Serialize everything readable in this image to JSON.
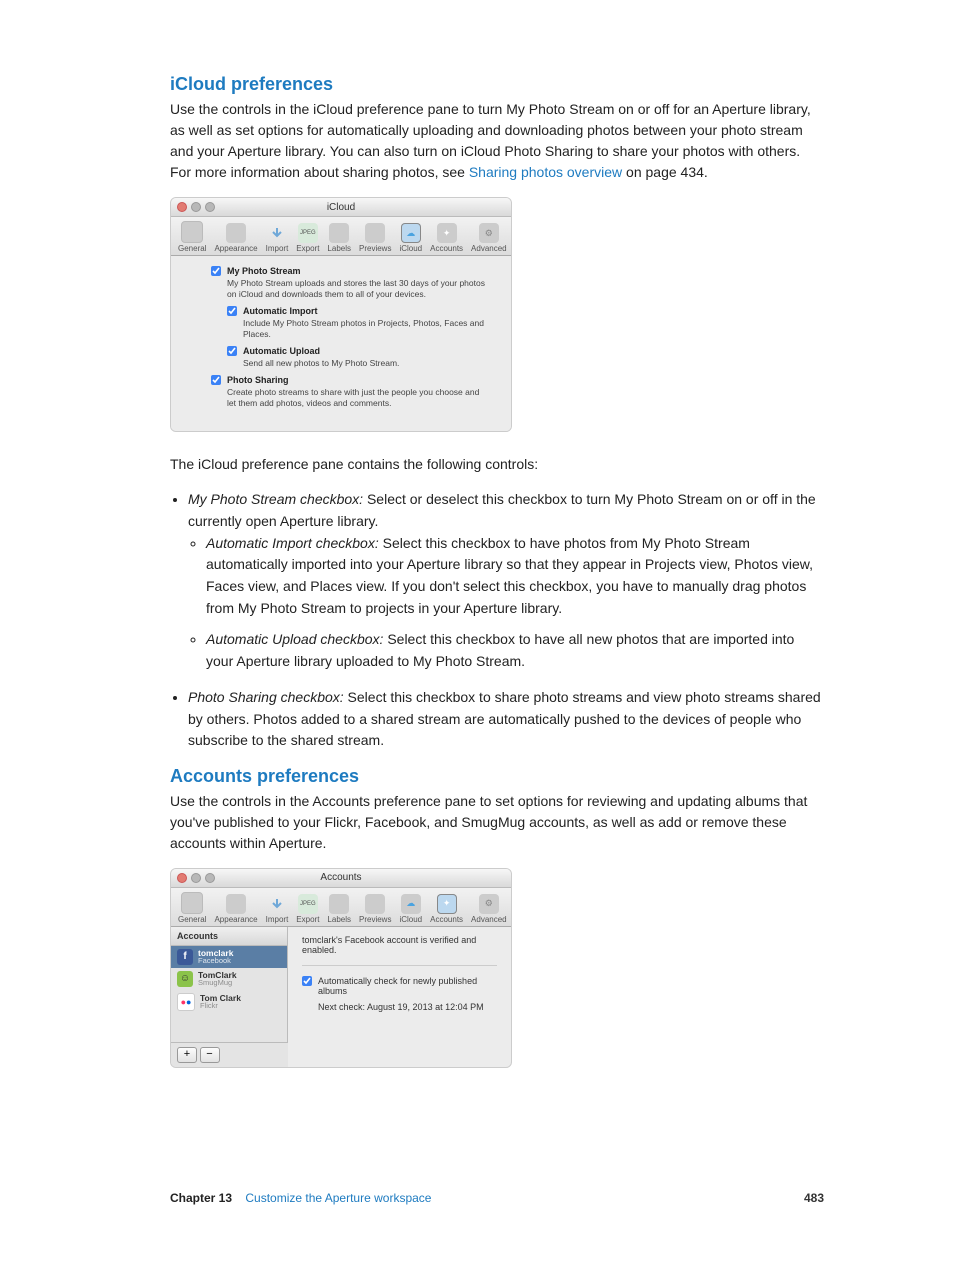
{
  "section1": {
    "title": "iCloud preferences",
    "intro_a": "Use the controls in the iCloud preference pane to turn My Photo Stream on or off for an Aperture library, as well as set options for automatically uploading and downloading photos between your photo stream and your Aperture library. You can also turn on iCloud Photo Sharing to share your photos with others. For more information about sharing photos, see ",
    "intro_link": "Sharing photos overview",
    "intro_b": " on page 434.",
    "lead_out": "The iCloud preference pane contains the following controls:"
  },
  "icloud_window": {
    "title": "iCloud",
    "tabs": [
      "General",
      "Appearance",
      "Import",
      "Export",
      "Labels",
      "Previews",
      "iCloud",
      "Accounts",
      "Advanced"
    ],
    "mps_label": "My Photo Stream",
    "mps_desc": "My Photo Stream uploads and stores the last 30 days of your photos on iCloud and downloads them to all of your devices.",
    "ai_label": "Automatic Import",
    "ai_desc": "Include My Photo Stream photos in Projects, Photos, Faces and Places.",
    "au_label": "Automatic Upload",
    "au_desc": "Send all new photos to My Photo Stream.",
    "ps_label": "Photo Sharing",
    "ps_desc": "Create photo streams to share with just the people you choose and let them add photos, videos and comments."
  },
  "bullets": {
    "b1_term": "My Photo Stream checkbox:",
    "b1_text": " Select or deselect this checkbox to turn My Photo Stream on or off in the currently open Aperture library.",
    "b1a_term": "Automatic Import checkbox:",
    "b1a_text": " Select this checkbox to have photos from My Photo Stream automatically imported into your Aperture library so that they appear in Projects view, Photos view, Faces view, and Places view. If you don't select this checkbox, you have to manually drag photos from My Photo Stream to projects in your Aperture library.",
    "b1b_term": "Automatic Upload checkbox:",
    "b1b_text": " Select this checkbox to have all new photos that are imported into your Aperture library uploaded to My Photo Stream.",
    "b2_term": "Photo Sharing checkbox:",
    "b2_text": " Select this checkbox to share photo streams and view photo streams shared by others. Photos added to a shared stream are automatically pushed to the devices of people who subscribe to the shared stream."
  },
  "section2": {
    "title": "Accounts preferences",
    "intro": "Use the controls in the Accounts preference pane to set options for reviewing and updating albums that you've published to your Flickr, Facebook, and SmugMug accounts, as well as add or remove these accounts within Aperture."
  },
  "accounts_window": {
    "title": "Accounts",
    "tabs": [
      "General",
      "Appearance",
      "Import",
      "Export",
      "Labels",
      "Previews",
      "iCloud",
      "Accounts",
      "Advanced"
    ],
    "side_head": "Accounts",
    "items": [
      {
        "name": "tomclark",
        "svc": "Facebook",
        "color": "#3b5998",
        "glyph": "f"
      },
      {
        "name": "TomClark",
        "svc": "SmugMug",
        "color": "#8bc34a",
        "glyph": "☺"
      },
      {
        "name": "Tom Clark",
        "svc": "Flickr",
        "color": "#fff",
        "glyph": "••"
      }
    ],
    "status": "tomclark's Facebook account is verified and enabled.",
    "auto_label": "Automatically check for newly published albums",
    "next_check": "Next check: August 19, 2013 at 12:04 PM",
    "add": "+",
    "remove": "−"
  },
  "footer": {
    "chapter": "Chapter 13",
    "name": "Customize the Aperture workspace",
    "page": "483"
  }
}
